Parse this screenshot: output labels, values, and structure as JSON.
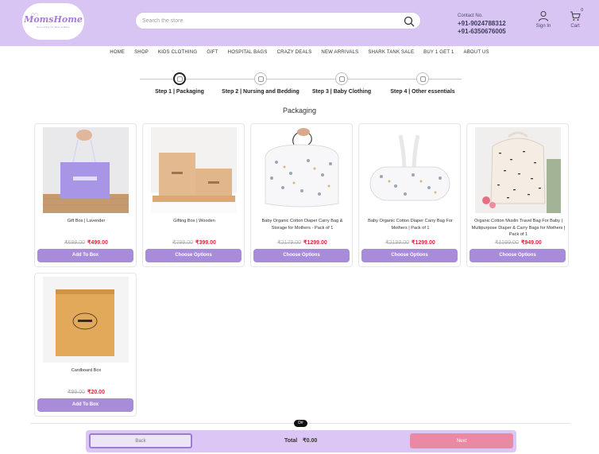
{
  "header": {
    "logo_text": "MomsHome",
    "logo_sub": "Everything for Mom & Baby",
    "search_placeholder": "Search the store",
    "contact_label": "Contact No.",
    "phone_1": "+91-9024788312",
    "phone_2": "+91-6350676005",
    "signin_label": "Sign In",
    "cart_label": "Cart",
    "cart_count": "0"
  },
  "nav": [
    "HOME",
    "SHOP",
    "KIDS CLOTHING",
    "GIFT",
    "HOSPITAL BAGS",
    "CRAZY DEALS",
    "NEW ARRIVALS",
    "SHARK TANK SALE",
    "BUY 1 GET 1",
    "ABOUT US"
  ],
  "steps": [
    {
      "label": "Step 1 | Packaging",
      "active": true
    },
    {
      "label": "Step 2 | Nursing and Bedding",
      "active": false
    },
    {
      "label": "Step 3 | Baby Clothing",
      "active": false
    },
    {
      "label": "Step 4 | Other essentials",
      "active": false
    }
  ],
  "section_title": "Packaging",
  "products": [
    {
      "name": "Gift Box | Lavender",
      "old_price": "₹699.00",
      "price": "₹499.00",
      "button": "Add To Box"
    },
    {
      "name": "Gifting Box | Wooden",
      "old_price": "₹799.00",
      "price": "₹399.00",
      "button": "Choose Options"
    },
    {
      "name": "Baby Organic Cotton Diaper Carry Bag & Storage for Mothers - Pack of 1",
      "old_price": "₹2179.00",
      "price": "₹1299.00",
      "button": "Choose Options"
    },
    {
      "name": "Baby Organic Cotton Diaper Carry Bag For Mothers | Pack of 1",
      "old_price": "₹2199.00",
      "price": "₹1299.00",
      "button": "Choose Options"
    },
    {
      "name": "Organic Cotton Muslin Travel Bag For Baby | Multipurpose Diaper & Carry Bags for Mothers | Pack of 1",
      "old_price": "₹1099.00",
      "price": "₹949.00",
      "button": "Choose Options"
    },
    {
      "name": "Cardboard Box",
      "old_price": "₹99.00",
      "price": "₹20.00",
      "button": "Add To Box"
    }
  ],
  "footer": {
    "badge": "D#",
    "back_label": "Back",
    "total_label": "Total",
    "total_value": "₹0.00",
    "next_label": "Next"
  },
  "colors": {
    "header_bg": "#d9c5f3",
    "button_purple": "#a88bd9",
    "price_red": "#e0223a",
    "next_pink": "#e989a4"
  }
}
